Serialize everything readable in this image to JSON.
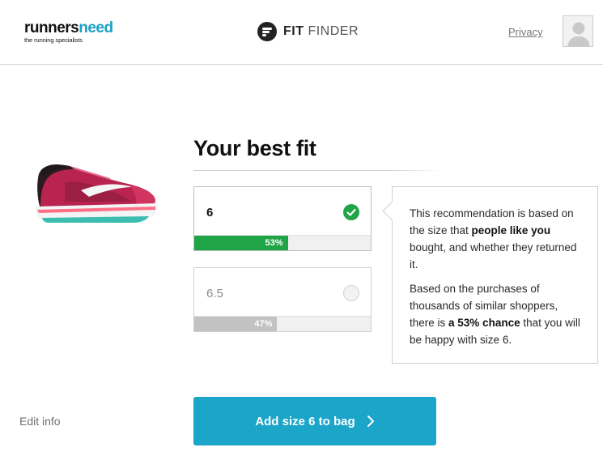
{
  "header": {
    "brand_part1": "runners",
    "brand_part2": "need",
    "brand_tagline": "the running specialists",
    "fit_label": "FIT",
    "finder_label": "FINDER",
    "privacy_link": "Privacy"
  },
  "main": {
    "title": "Your best fit",
    "sizes": [
      {
        "label": "6",
        "percent_label": "53%",
        "percent": 53,
        "selected": true
      },
      {
        "label": "6.5",
        "percent_label": "47%",
        "percent": 47,
        "selected": false
      }
    ],
    "info": {
      "para1_before": "This recommendation is based on the size that ",
      "para1_bold": "people like you",
      "para1_after": " bought, and whether they returned it.",
      "para2_before": "Based on the purchases of thousands of similar shoppers, there is ",
      "para2_bold": "a 53% chance",
      "para2_after": " that you will be happy with size 6."
    }
  },
  "footer": {
    "edit_info": "Edit info",
    "cta_label": "Add size 6 to bag"
  },
  "colors": {
    "accent": "#1aa5c9",
    "success": "#1fa447",
    "muted_bar": "#c2c2c2",
    "brand_blue": "#1aa0c8"
  },
  "icons": {
    "fitfinder_logo": "fit-finder-logo-icon",
    "avatar": "user-avatar-icon",
    "check": "checkmark-icon",
    "radio": "radio-empty-icon",
    "cta_arrow": "chevron-right-icon"
  }
}
